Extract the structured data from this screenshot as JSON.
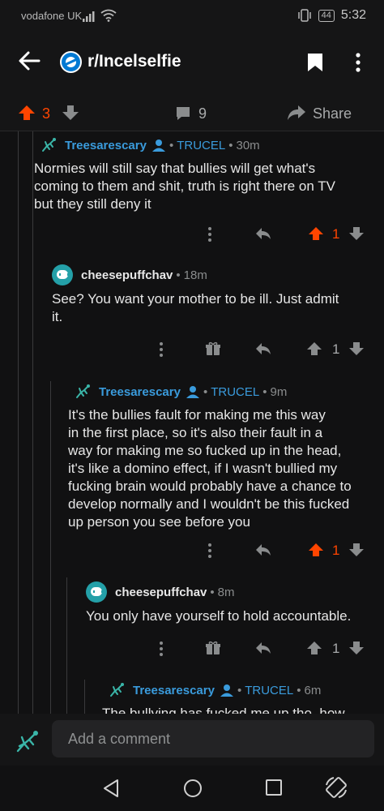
{
  "status_bar": {
    "carrier": "vodafone UK",
    "battery": "44",
    "time": "5:32"
  },
  "header": {
    "subreddit": "r/Incelselfie"
  },
  "post_actions": {
    "score": "3",
    "comment_count": "9",
    "share_label": "Share"
  },
  "comments": [
    {
      "username": "Treesarescary",
      "flair": "TRUCEL",
      "age": "30m",
      "lines": [
        "Normies will still say that bullies will get what's",
        "coming to them and shit, truth is right there on TV",
        "but they still deny it"
      ],
      "score": "1"
    },
    {
      "username": "cheesepuffchav",
      "age": "18m",
      "lines": [
        "See? You want your mother to be ill. Just admit",
        "it."
      ],
      "score": "1"
    },
    {
      "username": "Treesarescary",
      "flair": "TRUCEL",
      "age": "9m",
      "lines": [
        "It's the bullies fault for making me this way",
        "in the first place, so it's also their fault in a",
        "way for making me so fucked up in the head,",
        "it's like a domino effect, if I wasn't bullied my",
        "fucking brain would probably have a chance to",
        "develop normally and I wouldn't be this fucked",
        "up person you see before you"
      ],
      "score": "1"
    },
    {
      "username": "cheesepuffchav",
      "age": "8m",
      "lines": [
        "You only have yourself to hold accountable."
      ],
      "score": "1"
    },
    {
      "username": "Treesarescary",
      "flair": "TRUCEL",
      "age": "6m",
      "lines": [
        "The bullying has fucked me up tho, how"
      ]
    }
  ],
  "separator": "•",
  "comment_input": {
    "placeholder": "Add a comment"
  },
  "colors": {
    "accent_orange": "#ff4500",
    "username_blue": "#3a9bdc",
    "background": "#111112"
  }
}
